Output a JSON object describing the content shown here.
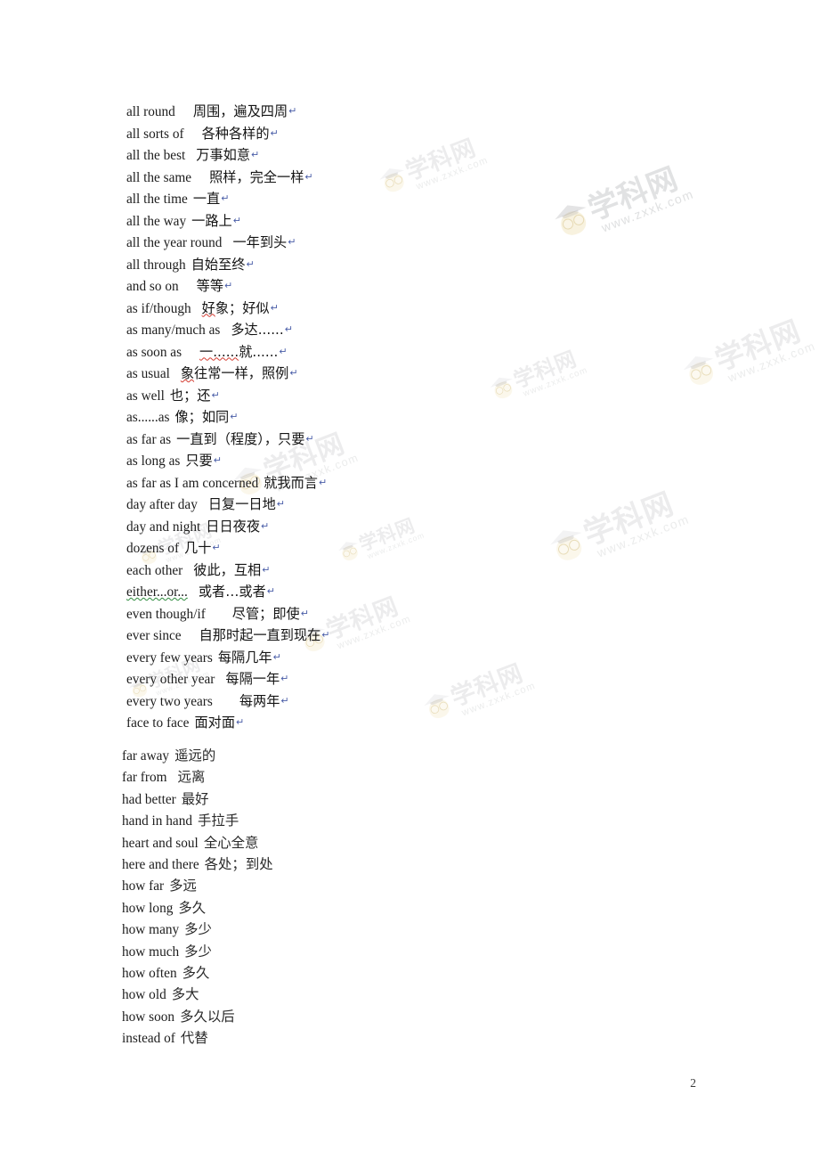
{
  "document": {
    "page_number": "2",
    "watermark": {
      "text_cn": "学科网",
      "text_url": "www.zxxk.com",
      "logo_name": "owl-graduation-cap-logo"
    }
  },
  "upper_block": {
    "entries": [
      {
        "en": "all round",
        "gap": "g3",
        "cn": "周围，遍及四周",
        "mark": "none",
        "pilcrow": "↵"
      },
      {
        "en": "all sorts of",
        "gap": "g3",
        "cn": "各种各样的",
        "mark": "none",
        "pilcrow": "↵"
      },
      {
        "en": "all the best",
        "gap": "g2",
        "cn": "万事如意",
        "mark": "none",
        "pilcrow": "↵"
      },
      {
        "en": "all the same",
        "gap": "g3",
        "cn": "照样，完全一样",
        "mark": "none",
        "pilcrow": "↵"
      },
      {
        "en": "all the time",
        "gap": "g1",
        "cn": "一直",
        "mark": "none",
        "pilcrow": "↵"
      },
      {
        "en": "all the way",
        "gap": "g1",
        "cn": "一路上",
        "mark": "none",
        "pilcrow": "↵"
      },
      {
        "en": "all the year round",
        "gap": "g2",
        "cn": "一年到头",
        "mark": "none",
        "pilcrow": "↵"
      },
      {
        "en": "all through",
        "gap": "g1",
        "cn": "自始至终",
        "mark": "none",
        "pilcrow": "↵"
      },
      {
        "en": "and so on",
        "gap": "g3",
        "cn": "等等",
        "mark": "none",
        "pilcrow": "↵"
      },
      {
        "en": "as if/though",
        "gap": "g2",
        "cn": "好象；好似",
        "mark": "red-first",
        "pilcrow": "↵"
      },
      {
        "en": "as many/much as",
        "gap": "g2",
        "cn": "多达......",
        "mark": "none",
        "pilcrow": "↵"
      },
      {
        "en": "as soon as",
        "gap": "g3",
        "cn": "一......就......",
        "mark": "red-first",
        "pilcrow": "↵"
      },
      {
        "en": "as usual",
        "gap": "g2",
        "cn": "象往常一样，照例",
        "mark": "red-first",
        "pilcrow": "↵"
      },
      {
        "en": "as well",
        "gap": "g1",
        "cn": "也；还",
        "mark": "none",
        "pilcrow": "↵"
      },
      {
        "en": "as......as",
        "gap": "g1",
        "cn": "像；如同",
        "mark": "none",
        "pilcrow": "↵"
      },
      {
        "en": "as far as",
        "gap": "g1",
        "cn": "一直到（程度），只要",
        "mark": "none",
        "pilcrow": "↵"
      },
      {
        "en": "as long as",
        "gap": "g1",
        "cn": "只要",
        "mark": "none",
        "pilcrow": "↵"
      },
      {
        "en": "as far as I am concerned",
        "gap": "g1",
        "cn": "就我而言",
        "mark": "none",
        "pilcrow": "↵"
      },
      {
        "en": "day after day",
        "gap": "g2",
        "cn": "日复一日地",
        "mark": "none",
        "pilcrow": "↵"
      },
      {
        "en": "day and night",
        "gap": "g1",
        "cn": "日日夜夜",
        "mark": "none",
        "pilcrow": "↵"
      },
      {
        "en": "dozens of",
        "gap": "g1",
        "cn": "几十",
        "mark": "none",
        "pilcrow": "↵"
      },
      {
        "en": "each other",
        "gap": "g2",
        "cn": "彼此，互相",
        "mark": "none",
        "pilcrow": "↵"
      },
      {
        "en": "either...or...",
        "gap": "g2",
        "cn": "或者…或者",
        "mark": "green-en",
        "pilcrow": "↵"
      },
      {
        "en": "even though/if",
        "gap": "g4",
        "cn": "尽管；即使",
        "mark": "none",
        "pilcrow": "↵"
      },
      {
        "en": "ever since",
        "gap": "g3",
        "cn": "自那时起一直到现在",
        "mark": "none",
        "pilcrow": "↵"
      },
      {
        "en": "every few years",
        "gap": "g1",
        "cn": "每隔几年",
        "mark": "none",
        "pilcrow": "↵"
      },
      {
        "en": "every other year",
        "gap": "g2",
        "cn": "每隔一年",
        "mark": "none",
        "pilcrow": "↵"
      },
      {
        "en": "every two years",
        "gap": "g4",
        "cn": "每两年",
        "mark": "none",
        "pilcrow": "↵"
      },
      {
        "en": "face to face",
        "gap": "g1",
        "cn": "面对面",
        "mark": "none",
        "pilcrow": "↵"
      }
    ]
  },
  "lower_block": {
    "entries": [
      {
        "en": "far away",
        "gap": "g1",
        "cn": "遥远的"
      },
      {
        "en": "far from",
        "gap": "g2",
        "cn": "远离"
      },
      {
        "en": "had better",
        "gap": "g1",
        "cn": "最好"
      },
      {
        "en": "hand in hand",
        "gap": "g1",
        "cn": "手拉手"
      },
      {
        "en": "heart and soul",
        "gap": "g1",
        "cn": "全心全意"
      },
      {
        "en": "here and there",
        "gap": "g1",
        "cn": "各处；到处"
      },
      {
        "en": "how far",
        "gap": "g1",
        "cn": "多远"
      },
      {
        "en": "how long",
        "gap": "g1",
        "cn": "多久"
      },
      {
        "en": "how many",
        "gap": "g1",
        "cn": "多少"
      },
      {
        "en": "how much",
        "gap": "g1",
        "cn": "多少"
      },
      {
        "en": "how often",
        "gap": "g1",
        "cn": "多久"
      },
      {
        "en": "how old",
        "gap": "g1",
        "cn": "多大"
      },
      {
        "en": "how soon",
        "gap": "g1",
        "cn": "多久以后"
      },
      {
        "en": "instead of",
        "gap": "g1",
        "cn": "代替"
      }
    ]
  }
}
